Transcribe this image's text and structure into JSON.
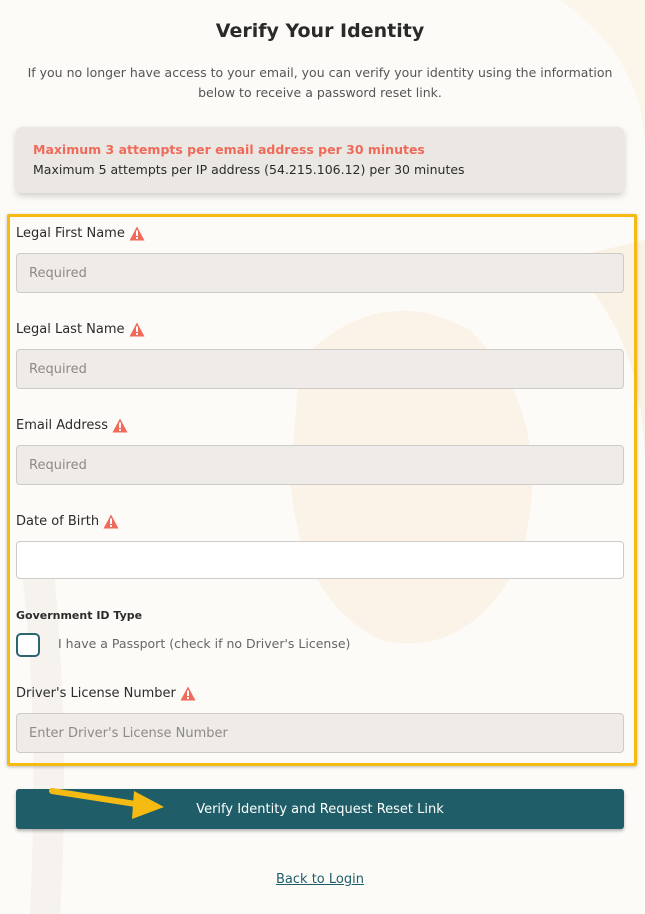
{
  "page": {
    "title": "Verify Your Identity",
    "subtitle": "If you no longer have access to your email, you can verify your identity using the information below to receive a password reset link."
  },
  "alert": {
    "line1": "Maximum 3 attempts per email address per 30 minutes",
    "line2": "Maximum 5 attempts per IP address (54.215.106.12) per 30 minutes"
  },
  "form": {
    "first_name": {
      "label": "Legal First Name",
      "placeholder": "Required",
      "value": ""
    },
    "last_name": {
      "label": "Legal Last Name",
      "placeholder": "Required",
      "value": ""
    },
    "email": {
      "label": "Email Address",
      "placeholder": "Required",
      "value": ""
    },
    "dob": {
      "label": "Date of Birth",
      "placeholder": "",
      "value": ""
    },
    "id_type": {
      "heading": "Government ID Type",
      "passport_label": "I have a Passport (check if no Driver's License)",
      "checked": false
    },
    "license": {
      "label": "Driver's License Number",
      "placeholder": "Enter Driver's License Number",
      "value": ""
    },
    "required_icon": "warning-triangle-icon"
  },
  "submit_label": "Verify Identity and Request Reset Link",
  "back_link": "Back to Login",
  "colors": {
    "accent": "#1f5e69",
    "warning": "#ef6a5a",
    "highlight": "#f6bb12"
  }
}
